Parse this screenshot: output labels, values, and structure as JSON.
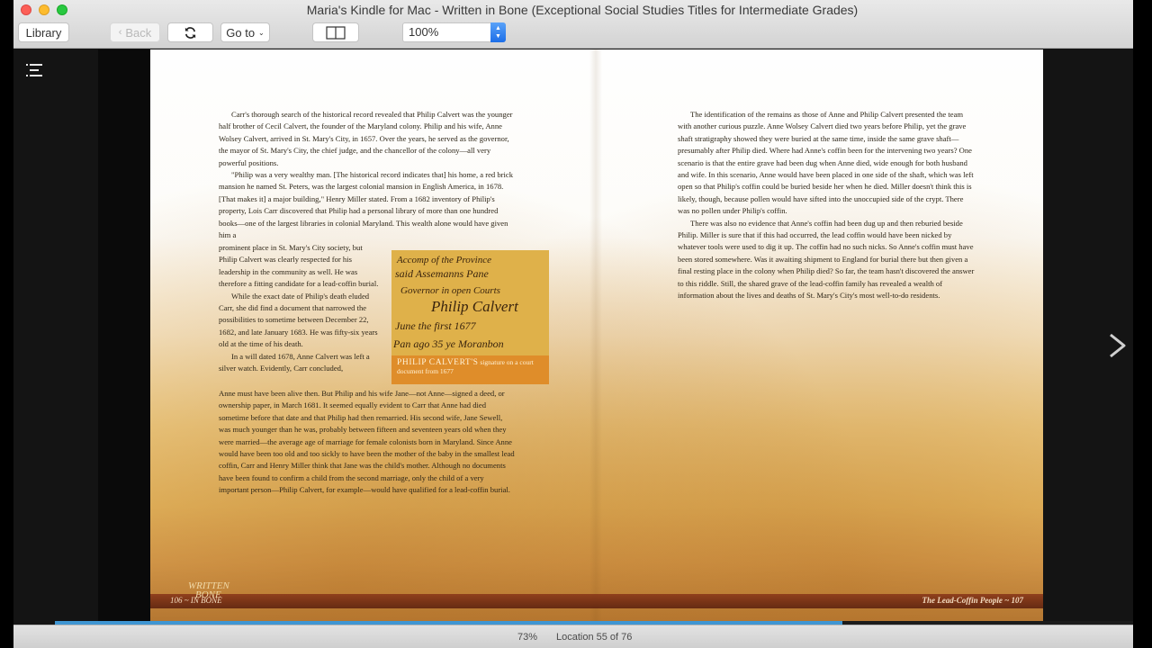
{
  "window": {
    "title": "Maria's Kindle for Mac - Written in Bone (Exceptional Social Studies Titles for Intermediate Grades)"
  },
  "toolbar": {
    "library_label": "Library",
    "back_label": "Back",
    "goto_label": "Go to",
    "zoom_value": "100%"
  },
  "book": {
    "left_page": {
      "paragraphs_top": [
        "Carr's thorough search of the historical record revealed that Philip Calvert was the younger half brother of Cecil Calvert, the founder of the Maryland colony. Philip and his wife, Anne Wolsey Calvert, arrived in St. Mary's City, in 1657. Over the years, he served as the governor, the mayor of St. Mary's City, the chief judge, and the chancellor of the colony—all very powerful positions.",
        "\"Philip was a very wealthy man. [The historical record indicates that] his home, a red brick mansion he named St. Peters, was the largest colonial mansion in English America, in 1678. [That makes it] a major building,\" Henry Miller stated. From a 1682 inventory of Philip's property, Lois Carr discovered that Philip had a personal library of more than one hundred books—one of the largest libraries in colonial Maryland. This wealth alone would have given him a"
      ],
      "paragraphs_narrow": [
        "prominent place in St. Mary's City society, but Philip Calvert was clearly respected for his leadership in the community as well. He was therefore a fitting candidate for a lead-coffin burial.",
        "While the exact date of Philip's death eluded Carr, she did find a document that narrowed the possibilities to sometime between December 22, 1682, and late January 1683. He was fifty-six years old at the time of his death.",
        "In a will dated 1678, Anne Calvert was left a silver watch. Evidently, Carr concluded,"
      ],
      "paragraph_bottom": "Anne must have been alive then. But Philip and his wife Jane—not Anne—signed a deed, or ownership paper, in March 1681. It seemed equally evident to Carr that Anne had died sometime before that date and that Philip had then remarried. His second wife, Jane Sewell, was much younger than he was, probably between fifteen and seventeen years old when they were married—the average age of marriage for female colonists born in Maryland. Since Anne would have been too old and too sickly to have been the mother of the baby in the smallest lead coffin, Carr and Henry Miller think that Jane was the child's mother. Although no documents have been found to confirm a child from the second marriage, only the child of a very important person—Philip Calvert, for example—would have qualified for a lead-coffin burial.",
      "inset": {
        "handwriting": [
          "Accomp of the Province",
          "said Assemanns Pane",
          "Governor in open Courts",
          "Philip Calvert",
          "June the first 1677",
          "Pan ago 35 ye Moranbon"
        ],
        "caption_name": "PHILIP CALVERT'S",
        "caption_text": " signature on a court document from 1677"
      },
      "footer": "106 ~ IN BONE",
      "logo_line1": "WRITTEN",
      "logo_line2": "BONE"
    },
    "right_page": {
      "paragraphs": [
        "The identification of the remains as those of Anne and Philip Calvert presented the team with another curious puzzle. Anne Wolsey Calvert died two years before Philip, yet the grave shaft stratigraphy showed they were buried at the same time, inside the same grave shaft—presumably after Philip died. Where had Anne's coffin been for the intervening two years? One scenario is that the entire grave had been dug when Anne died, wide enough for both husband and wife. In this scenario, Anne would have been placed in one side of the shaft, which was left open so that Philip's coffin could be buried beside her when he died. Miller doesn't think this is likely, though, because pollen would have sifted into the unoccupied side of the crypt. There was no pollen under Philip's coffin.",
        "There was also no evidence that Anne's coffin had been dug up and then reburied beside Philip. Miller is sure that if this had occurred, the lead coffin would have been nicked by whatever tools were used to dig it up. The coffin had no such nicks. So Anne's coffin must have been stored somewhere. Was it awaiting shipment to England for burial there but then given a final resting place in the colony when Philip died? So far, the team hasn't discovered the answer to this riddle. Still, the shared grave of the lead-coffin family has revealed a wealth of information about the lives and deaths of St. Mary's City's most well-to-do residents."
      ],
      "footer": "The Lead-Coffin People ~ 107"
    }
  },
  "status": {
    "percent": "73%",
    "location": "Location 55 of 76",
    "progress": 0.73
  },
  "colors": {
    "progress": "#3f96d3",
    "zoom_stepper": "#1c6ee8",
    "caption_bg": "#df8d2a"
  }
}
